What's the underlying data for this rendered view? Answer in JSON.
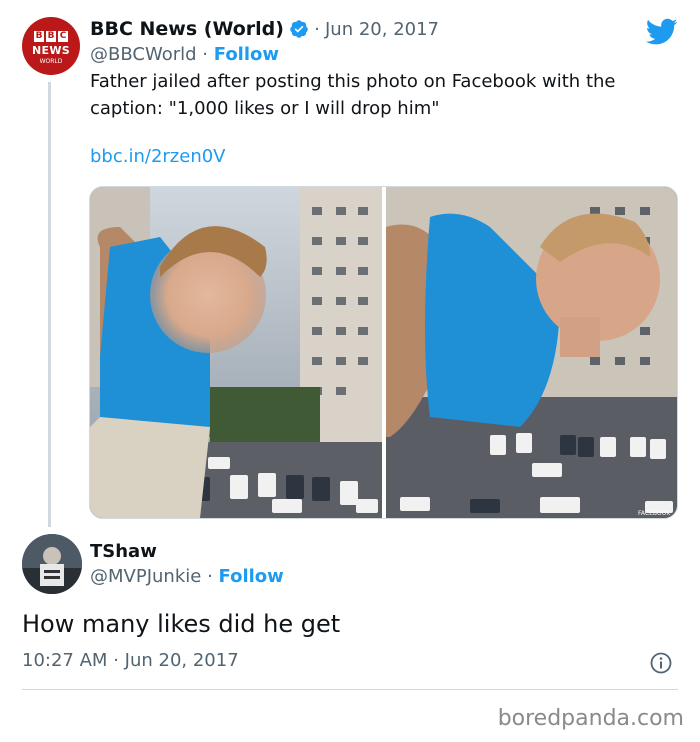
{
  "tweet": {
    "author_name": "BBC News (World)",
    "handle": "@BBCWorld",
    "separator": "·",
    "follow_label": "Follow",
    "date": "Jun 20, 2017",
    "text": "Father jailed after posting this photo on Facebook with the caption: \"1,000 likes or I will drop him\"",
    "link": "bbc.in/2rzen0V",
    "avatar": {
      "blocks": [
        "B",
        "B",
        "C"
      ],
      "line1": "NEWS",
      "line2": "WORLD"
    },
    "photo_watermark": "FACEBOOK"
  },
  "reply": {
    "author_name": "TShaw",
    "handle": "@MVPJunkie",
    "separator": "·",
    "follow_label": "Follow",
    "text": "How many likes did he get",
    "time": "10:27 AM",
    "date": "Jun 20, 2017"
  },
  "watermark": "boredpanda.com",
  "icons": {
    "verified": "verified-badge-icon",
    "twitter": "twitter-bird-icon",
    "info": "info-icon"
  },
  "colors": {
    "twitter_blue": "#1d9bf0",
    "bbc_red": "#bb1919",
    "muted": "#536471"
  }
}
